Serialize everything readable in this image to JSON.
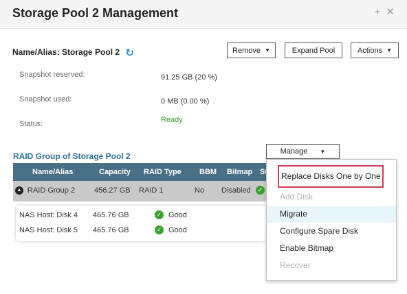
{
  "window": {
    "title": "Storage Pool 2 Management",
    "icons": [
      "plus-icon",
      "close-icon"
    ]
  },
  "header": {
    "name_label": "Name/Alias: Storage Pool 2",
    "buttons": {
      "remove": "Remove",
      "expand_pool": "Expand Pool",
      "actions": "Actions"
    }
  },
  "info": [
    {
      "label": "Snapshot reserved:",
      "value": "91.25 GB (20 %)"
    },
    {
      "label": "Snapshot used:",
      "value": "0 MB (0.00 %)"
    },
    {
      "label": "Status:",
      "value": "Ready",
      "color": "#3a9a2a"
    }
  ],
  "raid_section": {
    "title": "RAID Group of Storage Pool 2",
    "manage_label": "Manage",
    "columns": [
      "Name/Alias",
      "Capacity",
      "RAID Type",
      "BBM",
      "Bitmap",
      "St"
    ],
    "group": {
      "name": "RAID Group 2",
      "capacity": "456.27 GB",
      "raid_type": "RAID 1",
      "bbm": "No",
      "bitmap": "Disabled"
    },
    "disks": [
      {
        "name": "NAS Host: Disk 4",
        "capacity": "465.76 GB",
        "status": "Good"
      },
      {
        "name": "NAS Host: Disk 5",
        "capacity": "465.76 GB",
        "status": "Good"
      }
    ]
  },
  "manage_menu": {
    "items": [
      {
        "label": "Replace Disks One by One",
        "enabled": true,
        "highlighted": true
      },
      {
        "label": "Add Disk",
        "enabled": false
      },
      {
        "label": "Migrate",
        "enabled": true,
        "hover": true
      },
      {
        "label": "Configure Spare Disk",
        "enabled": true
      },
      {
        "label": "Enable Bitmap",
        "enabled": true
      },
      {
        "label": "Recover",
        "enabled": false
      }
    ]
  },
  "colors": {
    "header_bg": "#4a7087",
    "section_title": "#2b6e96",
    "ready": "#3a9a2a",
    "highlight_box": "#d23a5a",
    "hover_bg": "#e8f6fc"
  }
}
